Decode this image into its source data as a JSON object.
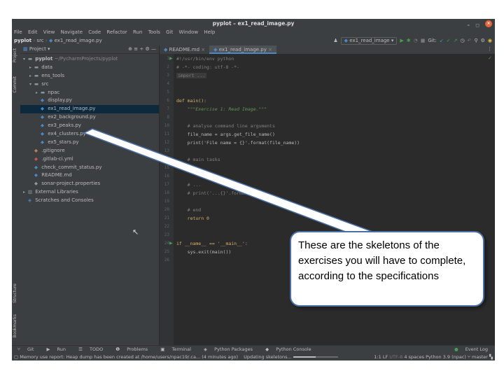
{
  "window": {
    "title": "pyplot – ex1_read_image.py",
    "controls": [
      "–",
      "◻",
      "×"
    ]
  },
  "menu": [
    "File",
    "Edit",
    "View",
    "Navigate",
    "Code",
    "Refactor",
    "Run",
    "Tools",
    "Git",
    "Window",
    "Help"
  ],
  "breadcrumb": [
    "pyplot",
    "src",
    "ex1_read_image.py"
  ],
  "toolbar": {
    "run_config": "ex1_read_image",
    "git_label": "Git:"
  },
  "side_tabs": {
    "project": "Project",
    "commit": "Commit",
    "structure": "Structure",
    "bookmarks": "Bookmarks"
  },
  "project_panel": {
    "title": "Project",
    "tree": [
      {
        "label": "pyplot",
        "suffix": "~/PycharmProjects/pyplot",
        "level": 0,
        "toggle": "▾",
        "icon": "folder-icon"
      },
      {
        "label": "data",
        "level": 1,
        "toggle": "▸",
        "icon": "folder-icon"
      },
      {
        "label": "ens_tools",
        "level": 1,
        "toggle": "▸",
        "icon": "folder-icon"
      },
      {
        "label": "src",
        "level": 1,
        "toggle": "▾",
        "icon": "folder-icon"
      },
      {
        "label": "npac",
        "level": 2,
        "toggle": "▸",
        "icon": "folder-icon"
      },
      {
        "label": "display.py",
        "level": 2,
        "toggle": "",
        "icon": "python-file-icon"
      },
      {
        "label": "ex1_read_image.py",
        "level": 2,
        "toggle": "",
        "icon": "python-file-icon",
        "selected": true
      },
      {
        "label": "ex2_background.py",
        "level": 2,
        "toggle": "",
        "icon": "python-file-icon"
      },
      {
        "label": "ex3_peaks.py",
        "level": 2,
        "toggle": "",
        "icon": "python-file-icon"
      },
      {
        "label": "ex4_clusters.py",
        "level": 2,
        "toggle": "",
        "icon": "python-file-icon"
      },
      {
        "label": "ex5_stars.py",
        "level": 2,
        "toggle": "",
        "icon": "python-file-icon"
      },
      {
        "label": ".gitignore",
        "level": 1,
        "toggle": "",
        "icon": "gitignore-file-icon"
      },
      {
        "label": ".gitlab-ci.yml",
        "level": 1,
        "toggle": "",
        "icon": "yaml-file-icon"
      },
      {
        "label": "check_commit_status.py",
        "level": 1,
        "toggle": "",
        "icon": "python-file-icon"
      },
      {
        "label": "README.md",
        "level": 1,
        "toggle": "",
        "icon": "markdown-file-icon"
      },
      {
        "label": "sonar-project.properties",
        "level": 1,
        "toggle": "",
        "icon": "properties-file-icon"
      },
      {
        "label": "External Libraries",
        "level": 0,
        "toggle": "▸",
        "icon": "library-icon"
      },
      {
        "label": "Scratches and Consoles",
        "level": 0,
        "toggle": "",
        "icon": "scratches-icon"
      }
    ]
  },
  "editor": {
    "tabs": [
      {
        "label": "README.md",
        "active": false
      },
      {
        "label": "ex1_read_image.py",
        "active": true
      }
    ],
    "lines": [
      {
        "n": "1",
        "text": "#!/usr/bin/env python",
        "kind": "comment",
        "run": true
      },
      {
        "n": "2",
        "text": "# -*- coding: utf-8 -*-",
        "kind": "comment"
      },
      {
        "n": "3",
        "text": "import ...",
        "kind": "fold"
      },
      {
        "n": "4",
        "text": "",
        "kind": "plain"
      },
      {
        "n": "5",
        "text": "",
        "kind": "plain"
      },
      {
        "n": "6",
        "text": "def main():",
        "kind": "def"
      },
      {
        "n": "7",
        "text": "    \"\"\"Exercise 1: Read Image.\"\"\"",
        "kind": "doc"
      },
      {
        "n": "8",
        "text": "",
        "kind": "plain"
      },
      {
        "n": "10",
        "text": "    # analyse command line arguments",
        "kind": "comment"
      },
      {
        "n": "11",
        "text": "    file_name = args.get_file_name()",
        "kind": "plain"
      },
      {
        "n": "12",
        "text": "    print('File name = {}'.format(file_name))",
        "kind": "plain"
      },
      {
        "n": "13",
        "text": "",
        "kind": "plain"
      },
      {
        "n": "14",
        "text": "    # main tasks",
        "kind": "comment"
      },
      {
        "n": "15",
        "text": "    # ...",
        "kind": "comment"
      },
      {
        "n": "16",
        "text": "",
        "kind": "plain"
      },
      {
        "n": "17",
        "text": "    # ...",
        "kind": "comment"
      },
      {
        "n": "18",
        "text": "    # print('...{}'.format(XXX))",
        "kind": "comment"
      },
      {
        "n": "19",
        "text": "",
        "kind": "plain"
      },
      {
        "n": "20",
        "text": "    # end",
        "kind": "comment"
      },
      {
        "n": "21",
        "text": "    return 0",
        "kind": "ret"
      },
      {
        "n": "22",
        "text": "",
        "kind": "plain"
      },
      {
        "n": "23",
        "text": "",
        "kind": "plain"
      },
      {
        "n": "24",
        "text": "if __name__ == '__main__':",
        "kind": "if",
        "run": true
      },
      {
        "n": "25",
        "text": "    sys.exit(main())",
        "kind": "plain"
      },
      {
        "n": "26",
        "text": "",
        "kind": "plain"
      }
    ]
  },
  "tool_windows": [
    "Git",
    "Run",
    "TODO",
    "Problems",
    "Terminal",
    "Python Packages",
    "Python Console"
  ],
  "event_log": "Event Log",
  "status": {
    "message": "Memory use report: Heap dump has been created at /home/users/npac19/.ca... (4 minutes ago)",
    "task": "Updating skeletons...",
    "progress": 0.5,
    "position": "1:1",
    "line_sep": "LF",
    "encoding": "UTF-8",
    "indent": "4 spaces",
    "interpreter": "Python 3.9 (npac)",
    "branch": "master"
  },
  "callout": {
    "text": "These are the skeletons of the exercises you will have to complete, according to the specifications"
  },
  "colors": {
    "keyword": "#cc7832",
    "comment": "#808080",
    "docstring": "#629755",
    "string": "#6a8759",
    "number": "#6897bb",
    "accent": "#4a6fa5"
  }
}
